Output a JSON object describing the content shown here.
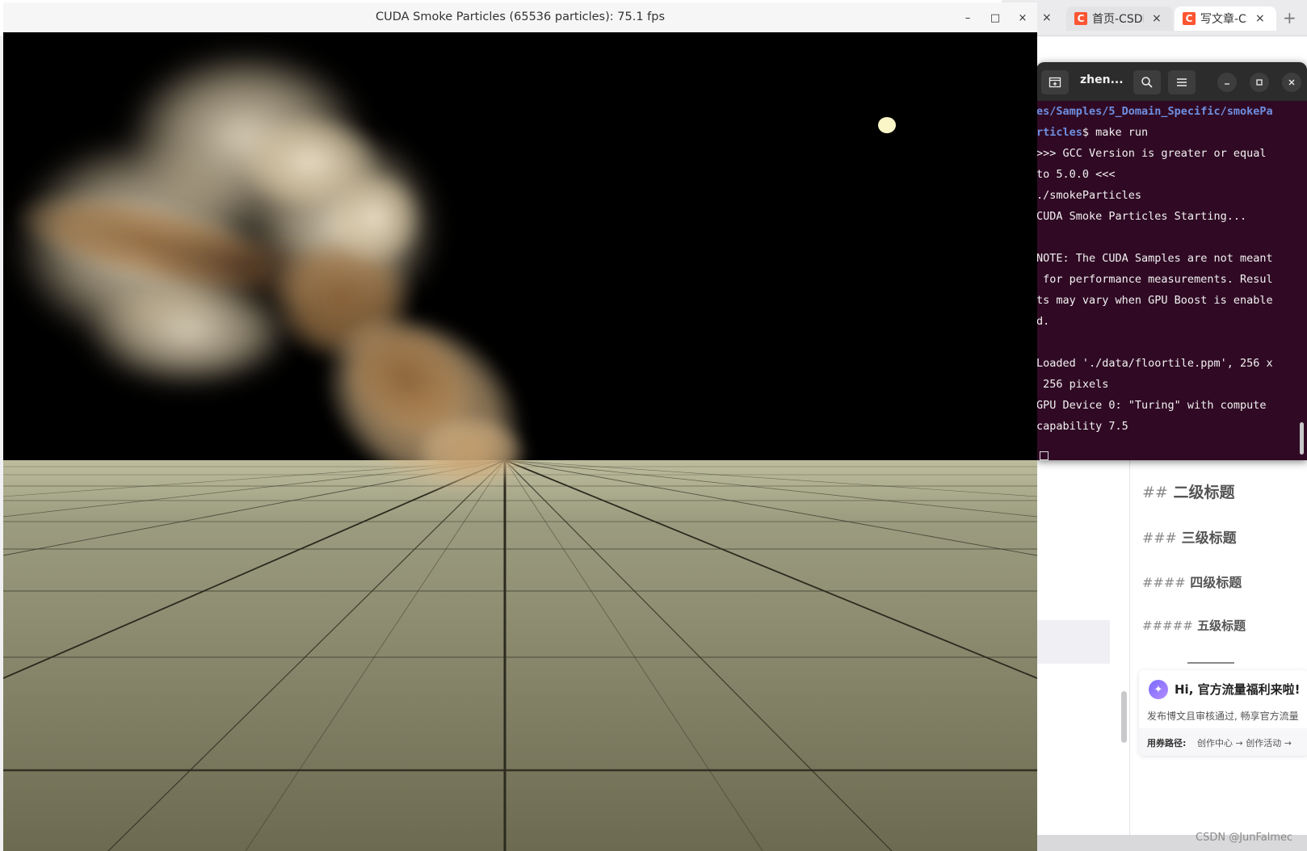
{
  "browser": {
    "tabs": [
      {
        "logo": "C",
        "title": "首页-CSDN",
        "close": "×"
      },
      {
        "logo": "C",
        "title": "写文章-CSDN",
        "close": "×"
      }
    ],
    "leading_close": "×",
    "new_tab": "+"
  },
  "editor": {
    "headings": [
      {
        "hash": "##",
        "text": "二级标题"
      },
      {
        "hash": "###",
        "text": "三级标题"
      },
      {
        "hash": "####",
        "text": "四级标题"
      },
      {
        "hash": "#####",
        "text": "五级标题"
      }
    ],
    "promo": {
      "title": "Hi, 官方流量福利来啦!",
      "desc": "发布博文且审核通过, 畅享官方流量",
      "path_label": "用券路径:",
      "path_value": "创作中心 → 创作活动 →"
    },
    "watermark": "CSDN @JunFalmec"
  },
  "terminal": {
    "title": "zhen...",
    "lines": [
      {
        "path": "es/Samples/5_Domain_Specific/smokePa",
        "text": ""
      },
      {
        "path": "rticles",
        "text": "$ make run"
      },
      {
        "path": "",
        "text": ">>> GCC Version is greater or equal"
      },
      {
        "path": "",
        "text": "to 5.0.0 <<<"
      },
      {
        "path": "",
        "text": "./smokeParticles"
      },
      {
        "path": "",
        "text": "CUDA Smoke Particles Starting..."
      },
      {
        "path": "",
        "text": ""
      },
      {
        "path": "",
        "text": "NOTE: The CUDA Samples are not meant"
      },
      {
        "path": "",
        "text": " for performance measurements. Resul"
      },
      {
        "path": "",
        "text": "ts may vary when GPU Boost is enable"
      },
      {
        "path": "",
        "text": "d."
      },
      {
        "path": "",
        "text": ""
      },
      {
        "path": "",
        "text": "Loaded './data/floortile.ppm', 256 x"
      },
      {
        "path": "",
        "text": " 256 pixels"
      },
      {
        "path": "",
        "text": "GPU Device 0: \"Turing\" with compute"
      },
      {
        "path": "",
        "text": "capability 7.5"
      }
    ]
  },
  "cuda_window": {
    "title": "CUDA Smoke Particles (65536 particles): 75.1 fps",
    "min": "–",
    "max": "□",
    "close": "×"
  },
  "colors": {
    "terminal_bg": "#300a24",
    "path_blue": "#6f8fe0",
    "csdn_red": "#fc5531",
    "smoke": "#c9a97a",
    "floor": "#9a9a80"
  }
}
